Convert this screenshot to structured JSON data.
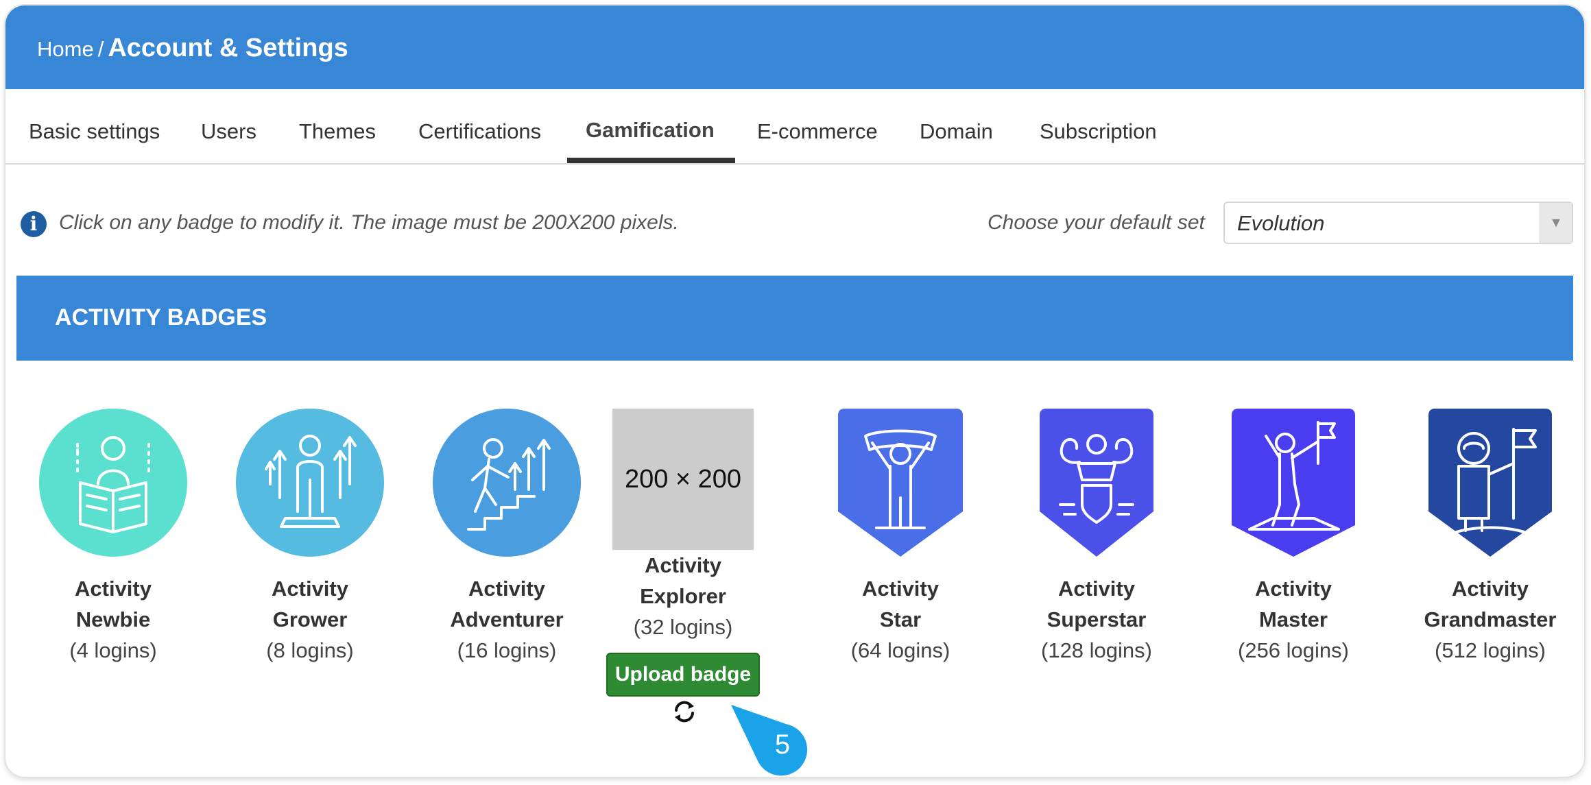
{
  "header": {
    "breadcrumb_home": "Home",
    "breadcrumb_sep": "/",
    "breadcrumb_current": "Account & Settings"
  },
  "tabs": [
    {
      "label": "Basic settings"
    },
    {
      "label": "Users"
    },
    {
      "label": "Themes"
    },
    {
      "label": "Certifications"
    },
    {
      "label": "Gamification",
      "active": true
    },
    {
      "label": "E-commerce"
    },
    {
      "label": "Domain"
    },
    {
      "label": "Subscription"
    }
  ],
  "info": {
    "icon": "info-icon",
    "text": "Click on any badge to modify it. The image must be 200X200 pixels.",
    "set_label": "Choose your default set",
    "set_value": "Evolution"
  },
  "section": {
    "title": "ACTIVITY BADGES"
  },
  "badges": [
    {
      "line1": "Activity",
      "line2": "Newbie",
      "sub": "(4 logins)",
      "color": "#5be0d0",
      "icon": "reader-icon"
    },
    {
      "line1": "Activity",
      "line2": "Grower",
      "sub": "(8 logins)",
      "color": "#55bbe0",
      "icon": "grower-icon"
    },
    {
      "line1": "Activity",
      "line2": "Adventurer",
      "sub": "(16 logins)",
      "color": "#4a9ee0",
      "icon": "stairs-icon"
    },
    {
      "line1": "Activity",
      "line2": "Explorer",
      "sub": "(32 logins)",
      "placeholder": "200 × 200"
    },
    {
      "line1": "Activity",
      "line2": "Star",
      "sub": "(64 logins)",
      "color": "#4a6de8",
      "icon": "champion-icon"
    },
    {
      "line1": "Activity",
      "line2": "Superstar",
      "sub": "(128 logins)",
      "color": "#4a50e8",
      "icon": "strongman-icon"
    },
    {
      "line1": "Activity",
      "line2": "Master",
      "sub": "(256 logins)",
      "color": "#4a3df0",
      "icon": "flag-summit-icon"
    },
    {
      "line1": "Activity",
      "line2": "Grandmaster",
      "sub": "(512 logins)",
      "color": "#2448a0",
      "icon": "astronaut-icon"
    }
  ],
  "upload": {
    "label": "Upload badge",
    "refresh_icon": "refresh-icon"
  },
  "callout": {
    "number": "5",
    "color": "#1aa3e8"
  }
}
